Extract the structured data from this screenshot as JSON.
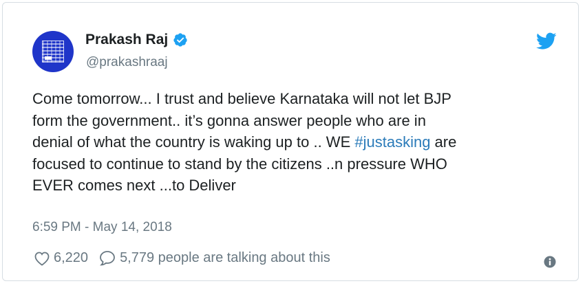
{
  "author": {
    "name": "Prakash Raj",
    "handle": "@prakashraaj",
    "verified": true,
    "avatar_color": "#1f35c9"
  },
  "tweet": {
    "lines": [
      "Come tomorrow... I trust and believe Karnataka will not let BJP",
      "form the government.. it’s gonna answer people who are in",
      "denial  of what the country is waking up to .. WE ",
      "focused to continue to stand by the citizens ..n pressure WHO",
      "EVER comes next ...to Deliver"
    ],
    "hashtag": "#justasking",
    "line3_after_hashtag": " are",
    "timestamp": "6:59 PM - May 14, 2018"
  },
  "actions": {
    "likes": "6,220",
    "replies_text": "5,779 people are talking about this"
  },
  "icons": {
    "brand": "twitter-bird-icon",
    "verified": "verified-badge-icon",
    "like": "heart-icon",
    "reply": "speech-bubble-icon",
    "info": "info-icon"
  },
  "colors": {
    "brand_blue": "#1da1f2",
    "hashtag": "#2b7bb9",
    "secondary_text": "#697882",
    "primary_text": "#1c2022"
  }
}
